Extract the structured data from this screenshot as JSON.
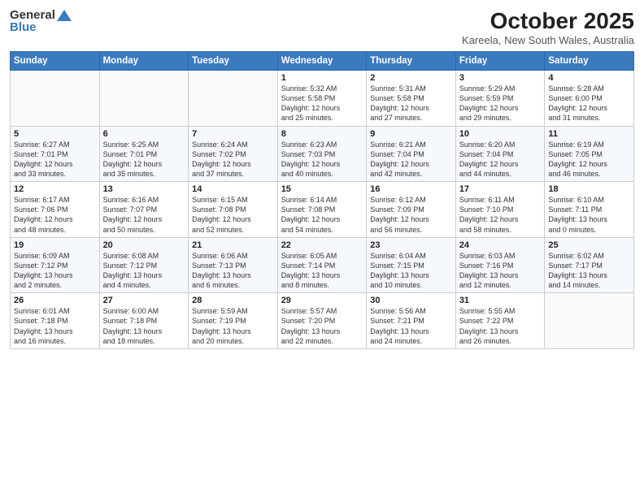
{
  "header": {
    "logo_general": "General",
    "logo_blue": "Blue",
    "month_title": "October 2025",
    "location": "Kareela, New South Wales, Australia"
  },
  "days_of_week": [
    "Sunday",
    "Monday",
    "Tuesday",
    "Wednesday",
    "Thursday",
    "Friday",
    "Saturday"
  ],
  "weeks": [
    [
      {
        "num": "",
        "info": ""
      },
      {
        "num": "",
        "info": ""
      },
      {
        "num": "",
        "info": ""
      },
      {
        "num": "1",
        "info": "Sunrise: 5:32 AM\nSunset: 5:58 PM\nDaylight: 12 hours\nand 25 minutes."
      },
      {
        "num": "2",
        "info": "Sunrise: 5:31 AM\nSunset: 5:58 PM\nDaylight: 12 hours\nand 27 minutes."
      },
      {
        "num": "3",
        "info": "Sunrise: 5:29 AM\nSunset: 5:59 PM\nDaylight: 12 hours\nand 29 minutes."
      },
      {
        "num": "4",
        "info": "Sunrise: 5:28 AM\nSunset: 6:00 PM\nDaylight: 12 hours\nand 31 minutes."
      }
    ],
    [
      {
        "num": "5",
        "info": "Sunrise: 6:27 AM\nSunset: 7:01 PM\nDaylight: 12 hours\nand 33 minutes."
      },
      {
        "num": "6",
        "info": "Sunrise: 6:25 AM\nSunset: 7:01 PM\nDaylight: 12 hours\nand 35 minutes."
      },
      {
        "num": "7",
        "info": "Sunrise: 6:24 AM\nSunset: 7:02 PM\nDaylight: 12 hours\nand 37 minutes."
      },
      {
        "num": "8",
        "info": "Sunrise: 6:23 AM\nSunset: 7:03 PM\nDaylight: 12 hours\nand 40 minutes."
      },
      {
        "num": "9",
        "info": "Sunrise: 6:21 AM\nSunset: 7:04 PM\nDaylight: 12 hours\nand 42 minutes."
      },
      {
        "num": "10",
        "info": "Sunrise: 6:20 AM\nSunset: 7:04 PM\nDaylight: 12 hours\nand 44 minutes."
      },
      {
        "num": "11",
        "info": "Sunrise: 6:19 AM\nSunset: 7:05 PM\nDaylight: 12 hours\nand 46 minutes."
      }
    ],
    [
      {
        "num": "12",
        "info": "Sunrise: 6:17 AM\nSunset: 7:06 PM\nDaylight: 12 hours\nand 48 minutes."
      },
      {
        "num": "13",
        "info": "Sunrise: 6:16 AM\nSunset: 7:07 PM\nDaylight: 12 hours\nand 50 minutes."
      },
      {
        "num": "14",
        "info": "Sunrise: 6:15 AM\nSunset: 7:08 PM\nDaylight: 12 hours\nand 52 minutes."
      },
      {
        "num": "15",
        "info": "Sunrise: 6:14 AM\nSunset: 7:08 PM\nDaylight: 12 hours\nand 54 minutes."
      },
      {
        "num": "16",
        "info": "Sunrise: 6:12 AM\nSunset: 7:09 PM\nDaylight: 12 hours\nand 56 minutes."
      },
      {
        "num": "17",
        "info": "Sunrise: 6:11 AM\nSunset: 7:10 PM\nDaylight: 12 hours\nand 58 minutes."
      },
      {
        "num": "18",
        "info": "Sunrise: 6:10 AM\nSunset: 7:11 PM\nDaylight: 13 hours\nand 0 minutes."
      }
    ],
    [
      {
        "num": "19",
        "info": "Sunrise: 6:09 AM\nSunset: 7:12 PM\nDaylight: 13 hours\nand 2 minutes."
      },
      {
        "num": "20",
        "info": "Sunrise: 6:08 AM\nSunset: 7:12 PM\nDaylight: 13 hours\nand 4 minutes."
      },
      {
        "num": "21",
        "info": "Sunrise: 6:06 AM\nSunset: 7:13 PM\nDaylight: 13 hours\nand 6 minutes."
      },
      {
        "num": "22",
        "info": "Sunrise: 6:05 AM\nSunset: 7:14 PM\nDaylight: 13 hours\nand 8 minutes."
      },
      {
        "num": "23",
        "info": "Sunrise: 6:04 AM\nSunset: 7:15 PM\nDaylight: 13 hours\nand 10 minutes."
      },
      {
        "num": "24",
        "info": "Sunrise: 6:03 AM\nSunset: 7:16 PM\nDaylight: 13 hours\nand 12 minutes."
      },
      {
        "num": "25",
        "info": "Sunrise: 6:02 AM\nSunset: 7:17 PM\nDaylight: 13 hours\nand 14 minutes."
      }
    ],
    [
      {
        "num": "26",
        "info": "Sunrise: 6:01 AM\nSunset: 7:18 PM\nDaylight: 13 hours\nand 16 minutes."
      },
      {
        "num": "27",
        "info": "Sunrise: 6:00 AM\nSunset: 7:18 PM\nDaylight: 13 hours\nand 18 minutes."
      },
      {
        "num": "28",
        "info": "Sunrise: 5:59 AM\nSunset: 7:19 PM\nDaylight: 13 hours\nand 20 minutes."
      },
      {
        "num": "29",
        "info": "Sunrise: 5:57 AM\nSunset: 7:20 PM\nDaylight: 13 hours\nand 22 minutes."
      },
      {
        "num": "30",
        "info": "Sunrise: 5:56 AM\nSunset: 7:21 PM\nDaylight: 13 hours\nand 24 minutes."
      },
      {
        "num": "31",
        "info": "Sunrise: 5:55 AM\nSunset: 7:22 PM\nDaylight: 13 hours\nand 26 minutes."
      },
      {
        "num": "",
        "info": ""
      }
    ]
  ]
}
